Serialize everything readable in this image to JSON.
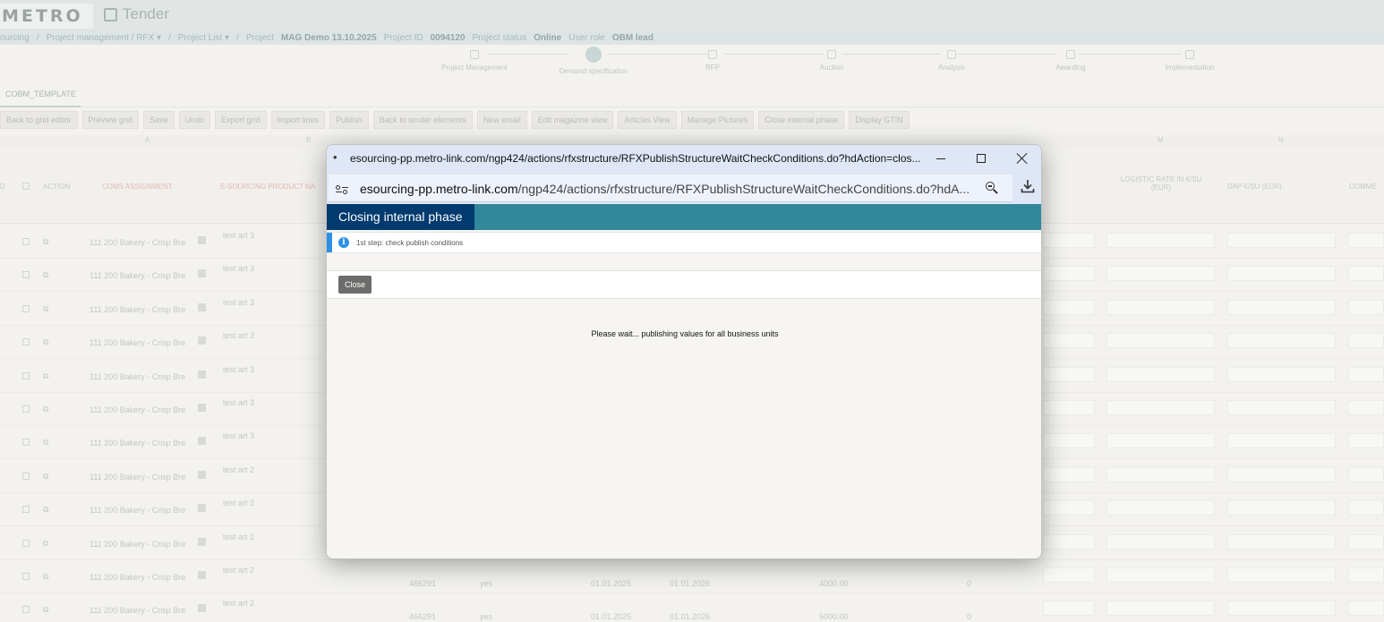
{
  "app": {
    "logo_text": "METRO",
    "title": "Tender",
    "breadcrumb_parts": [
      "ourcing",
      "/",
      "Project management / RFX ▾",
      "/",
      "Project List ▾",
      "/",
      "Project"
    ],
    "project_name": "MAG Demo 13.10.2025",
    "project_id_label": "Project ID",
    "project_id": "0094120",
    "project_status_label": "Project status",
    "project_status": "Online",
    "user_role_label": "User role",
    "user_role": "OBM lead"
  },
  "steps": [
    "Project Management",
    "Demand specification",
    "RFP",
    "Auction",
    "Analysis",
    "Awarding",
    "Implementation"
  ],
  "tab": "COBM_TEMPLATE",
  "toolbar": [
    "Back to grid editor",
    "Preview grid",
    "Save",
    "Undo",
    "Export grid",
    "Import lines",
    "Publish",
    "Back to tender elements",
    "New email",
    "Edit magazine view",
    "Articles View",
    "Manage Pictures",
    "Close internal phase",
    "Display GTIN"
  ],
  "grid": {
    "letters": [
      "A",
      "B",
      "M",
      "N"
    ],
    "headers": {
      "id": "D",
      "action": "ACTION",
      "coms": "COMS ASSIGNMENT",
      "product": "E-SOURCING PRODUCT NA",
      "logistic": "LOGISTIC RATE IN €/SU (EUR)",
      "dap": "DAP €/SU (EUR)",
      "comment": "COMME"
    },
    "rows": [
      {
        "coms": "111 200 Bakery - Crisp Bre",
        "product": "test art 3"
      },
      {
        "coms": "111 200 Bakery - Crisp Bre",
        "product": "test art 3"
      },
      {
        "coms": "111 200 Bakery - Crisp Bre",
        "product": "test art 3"
      },
      {
        "coms": "111 200 Bakery - Crisp Bre",
        "product": "test art 3"
      },
      {
        "coms": "111 200 Bakery - Crisp Bre",
        "product": "test art 3"
      },
      {
        "coms": "111 200 Bakery - Crisp Bre",
        "product": "test art 3"
      },
      {
        "coms": "111 200 Bakery - Crisp Bre",
        "product": "test art 3"
      },
      {
        "coms": "111 200 Bakery - Crisp Bre",
        "product": "test art 2"
      },
      {
        "coms": "111 200 Bakery - Crisp Bre",
        "product": "test art 2"
      },
      {
        "coms": "111 200 Bakery - Crisp Bre",
        "product": "test art 2"
      },
      {
        "coms": "111 200 Bakery - Crisp Bre",
        "product": "test art 2"
      },
      {
        "coms": "111 200 Bakery - Crisp Bre",
        "product": "test art 2"
      }
    ],
    "bottom_rows": [
      {
        "num": "466291",
        "yes": "yes",
        "from": "01.01.2025",
        "to": "01.01.2026",
        "value": "4000.00",
        "zero": "0"
      },
      {
        "num": "466291",
        "yes": "yes",
        "from": "01.01.2025",
        "to": "01.01.2026",
        "value": "5000.00",
        "zero": "0"
      }
    ]
  },
  "popup": {
    "title_url": "esourcing-pp.metro-link.com/ngp424/actions/rfxstructure/RFXPublishStructureWaitCheckConditions.do?hdAction=clos...",
    "address_host": "esourcing-pp.metro-link.com",
    "address_path": "/ngp424/actions/rfxstructure/RFXPublishStructureWaitCheckConditions.do?hdA...",
    "favicon_char": "•",
    "page_title": "Closing internal phase",
    "info_text": "1st step: check publish conditions",
    "info_icon_char": "i",
    "close_label": "Close",
    "wait_message": "Please wait... publishing values for all business units"
  }
}
